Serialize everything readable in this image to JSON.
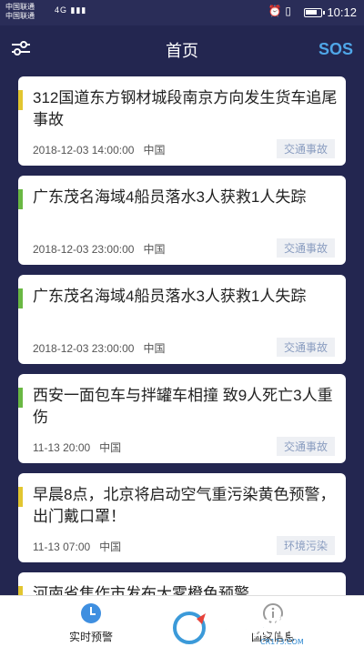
{
  "status_bar": {
    "carrier1": "中国联通",
    "carrier2": "中国联通",
    "signal_text": "4G",
    "time": "10:12"
  },
  "header": {
    "title": "首页",
    "sos_label": "SOS"
  },
  "cards": [
    {
      "title": "312国道东方钢材城段南京方向发生货车追尾事故",
      "date": "2018-12-03 14:00:00",
      "region": "中国",
      "tag": "交通事故",
      "accent": "#e2c630"
    },
    {
      "title": "广东茂名海域4船员落水3人获救1人失踪",
      "date": "2018-12-03 23:00:00",
      "region": "中国",
      "tag": "交通事故",
      "accent": "#6ab843"
    },
    {
      "title": "广东茂名海域4船员落水3人获救1人失踪",
      "date": "2018-12-03 23:00:00",
      "region": "中国",
      "tag": "交通事故",
      "accent": "#6ab843"
    },
    {
      "title": "西安一面包车与拌罐车相撞 致9人死亡3人重伤",
      "date": "11-13 20:00",
      "region": "中国",
      "tag": "交通事故",
      "accent": "#6ab843"
    },
    {
      "title": "早晨8点，北京将启动空气重污染黄色预警，出门戴口罩！",
      "date": "11-13 07:00",
      "region": "中国",
      "tag": "环境污染",
      "accent": "#e2c630"
    },
    {
      "title": "河南省焦作市发布大雾橙色预警",
      "date": "",
      "region": "",
      "tag": "",
      "accent": "#e2c630"
    }
  ],
  "bottom_nav": {
    "items": [
      {
        "label": "实时预警",
        "icon": "clock-icon"
      },
      {
        "label": "国家信息",
        "icon": "info-icon"
      }
    ]
  },
  "watermark": {
    "text": "西西软件园",
    "sub": "CR173.COM"
  },
  "colors": {
    "background": "#232650",
    "accent_blue": "#4fa6e8"
  }
}
